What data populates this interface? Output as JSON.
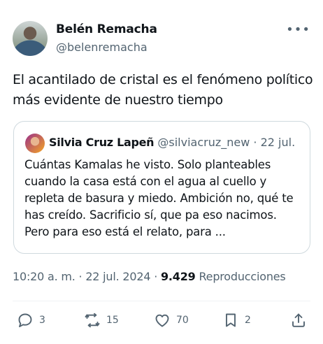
{
  "author": {
    "name": "Belén Remacha",
    "handle": "@belenremacha"
  },
  "more_icon": "•••",
  "tweet": {
    "text": "El acantilado de cristal es el fenómeno político más evidente de nuestro tiempo"
  },
  "quoted": {
    "name": "Silvia Cruz Lapeñ",
    "handle": "@silviacruz_new",
    "separator": "·",
    "date": "22 jul.",
    "text": "Cuántas Kamalas he visto. Solo planteables cuando la casa está con el agua al cuello y repleta de basura y miedo. Ambición no, qué te has creído. Sacrificio sí, que pa eso nacimos. Pero para eso está el relato, para ..."
  },
  "meta": {
    "time": "10:20 a. m.",
    "sep1": "·",
    "date": "22 jul. 2024",
    "sep2": "·",
    "views": "9.429",
    "views_label": "Reproducciones"
  },
  "actions": {
    "reply_count": "3",
    "retweet_count": "15",
    "like_count": "70",
    "bookmark_count": "2"
  }
}
